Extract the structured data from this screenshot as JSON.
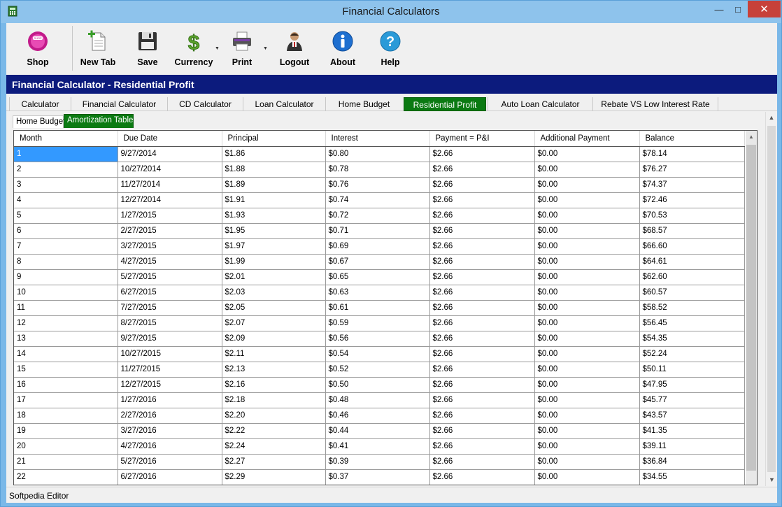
{
  "window": {
    "title": "Financial Calculators"
  },
  "toolbar": {
    "shop": "Shop",
    "new_tab": "New Tab",
    "save": "Save",
    "currency": "Currency",
    "print": "Print",
    "logout": "Logout",
    "about": "About",
    "help": "Help"
  },
  "header": {
    "title": "Financial Calculator - Residential Profit"
  },
  "main_tabs": [
    "Calculator",
    "Financial Calculator",
    "CD Calculator",
    "Loan Calculator",
    "Home Budget",
    "Residential Profit",
    "Auto Loan Calculator",
    "Rebate VS Low Interest Rate"
  ],
  "active_main_tab": "Residential Profit",
  "sub_tabs": [
    "Home Budget",
    "Amortization Table"
  ],
  "active_sub_tab": "Amortization Table",
  "table": {
    "columns": [
      "Month",
      "Due Date",
      "Principal",
      "Interest",
      "Payment = P&I",
      "Additional Payment",
      "Balance"
    ],
    "rows": [
      [
        "1",
        "9/27/2014",
        "$1.86",
        "$0.80",
        "$2.66",
        "$0.00",
        "$78.14"
      ],
      [
        "2",
        "10/27/2014",
        "$1.88",
        "$0.78",
        "$2.66",
        "$0.00",
        "$76.27"
      ],
      [
        "3",
        "11/27/2014",
        "$1.89",
        "$0.76",
        "$2.66",
        "$0.00",
        "$74.37"
      ],
      [
        "4",
        "12/27/2014",
        "$1.91",
        "$0.74",
        "$2.66",
        "$0.00",
        "$72.46"
      ],
      [
        "5",
        "1/27/2015",
        "$1.93",
        "$0.72",
        "$2.66",
        "$0.00",
        "$70.53"
      ],
      [
        "6",
        "2/27/2015",
        "$1.95",
        "$0.71",
        "$2.66",
        "$0.00",
        "$68.57"
      ],
      [
        "7",
        "3/27/2015",
        "$1.97",
        "$0.69",
        "$2.66",
        "$0.00",
        "$66.60"
      ],
      [
        "8",
        "4/27/2015",
        "$1.99",
        "$0.67",
        "$2.66",
        "$0.00",
        "$64.61"
      ],
      [
        "9",
        "5/27/2015",
        "$2.01",
        "$0.65",
        "$2.66",
        "$0.00",
        "$62.60"
      ],
      [
        "10",
        "6/27/2015",
        "$2.03",
        "$0.63",
        "$2.66",
        "$0.00",
        "$60.57"
      ],
      [
        "11",
        "7/27/2015",
        "$2.05",
        "$0.61",
        "$2.66",
        "$0.00",
        "$58.52"
      ],
      [
        "12",
        "8/27/2015",
        "$2.07",
        "$0.59",
        "$2.66",
        "$0.00",
        "$56.45"
      ],
      [
        "13",
        "9/27/2015",
        "$2.09",
        "$0.56",
        "$2.66",
        "$0.00",
        "$54.35"
      ],
      [
        "14",
        "10/27/2015",
        "$2.11",
        "$0.54",
        "$2.66",
        "$0.00",
        "$52.24"
      ],
      [
        "15",
        "11/27/2015",
        "$2.13",
        "$0.52",
        "$2.66",
        "$0.00",
        "$50.11"
      ],
      [
        "16",
        "12/27/2015",
        "$2.16",
        "$0.50",
        "$2.66",
        "$0.00",
        "$47.95"
      ],
      [
        "17",
        "1/27/2016",
        "$2.18",
        "$0.48",
        "$2.66",
        "$0.00",
        "$45.77"
      ],
      [
        "18",
        "2/27/2016",
        "$2.20",
        "$0.46",
        "$2.66",
        "$0.00",
        "$43.57"
      ],
      [
        "19",
        "3/27/2016",
        "$2.22",
        "$0.44",
        "$2.66",
        "$0.00",
        "$41.35"
      ],
      [
        "20",
        "4/27/2016",
        "$2.24",
        "$0.41",
        "$2.66",
        "$0.00",
        "$39.11"
      ],
      [
        "21",
        "5/27/2016",
        "$2.27",
        "$0.39",
        "$2.66",
        "$0.00",
        "$36.84"
      ],
      [
        "22",
        "6/27/2016",
        "$2.29",
        "$0.37",
        "$2.66",
        "$0.00",
        "$34.55"
      ]
    ]
  },
  "status": {
    "text": "Softpedia Editor"
  },
  "colors": {
    "header_band": "#0c1b7d",
    "active_tab": "#0b7a12",
    "selection": "#3399ff"
  }
}
